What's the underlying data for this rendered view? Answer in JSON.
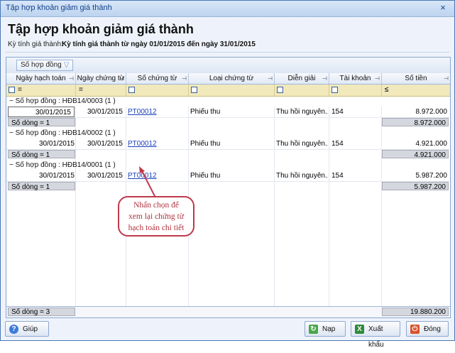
{
  "window": {
    "title": "Tập hợp khoản giảm giá thành",
    "close_glyph": "×"
  },
  "header": {
    "title": "Tập hợp khoản giảm giá thành",
    "period_label": "Kỳ tính giá thành:",
    "period_value": "Kỳ tính giá thành từ ngày 01/01/2015 đến ngày 31/01/2015"
  },
  "grid": {
    "group_by_chip": "Số hợp đồng",
    "columns": [
      "Ngày hạch toán",
      "Ngày chứng từ",
      "Số chứng từ",
      "Loại chứng từ",
      "Diễn giải",
      "Tài khoản",
      "Số tiền"
    ],
    "filter_ops": {
      "date": "=",
      "doc_date": "=",
      "amount": "≤"
    },
    "groups": [
      {
        "caption": "Số hợp đồng : HĐB14/0003 (1 )",
        "rows": [
          {
            "posting_date": "30/01/2015",
            "doc_date": "30/01/2015",
            "doc_no": "PT00012",
            "doc_type": "Phiếu thu",
            "description": "Thu hồi nguyên...",
            "account": "154",
            "amount": "8.972.000"
          }
        ],
        "summary_label": "Số dòng = 1",
        "summary_amount": "8.972.000"
      },
      {
        "caption": "Số hợp đồng : HĐB14/0002 (1 )",
        "rows": [
          {
            "posting_date": "30/01/2015",
            "doc_date": "30/01/2015",
            "doc_no": "PT00012",
            "doc_type": "Phiếu thu",
            "description": "Thu hồi nguyên...",
            "account": "154",
            "amount": "4.921.000"
          }
        ],
        "summary_label": "Số dòng = 1",
        "summary_amount": "4.921.000"
      },
      {
        "caption": "Số hợp đồng : HĐB14/0001 (1 )",
        "rows": [
          {
            "posting_date": "30/01/2015",
            "doc_date": "30/01/2015",
            "doc_no": "PT00012",
            "doc_type": "Phiếu thu",
            "description": "Thu hồi nguyên...",
            "account": "154",
            "amount": "5.987.200"
          }
        ],
        "summary_label": "Số dòng = 1",
        "summary_amount": "5.987.200"
      }
    ],
    "total_label": "Số dòng = 3",
    "total_amount": "19.880.200"
  },
  "callout": {
    "line1": "Nhấn chọn để",
    "line2": "xem lại chứng từ",
    "line3": "hạch toán chi tiết"
  },
  "buttons": {
    "help": "Giúp",
    "refresh": "Nạp",
    "export": "Xuất khẩu",
    "close": "Đóng"
  },
  "colors": {
    "title_text": "#15428b",
    "link": "#1a3fbf",
    "filter_row": "#f1e9bc",
    "callout": "#c0394b"
  }
}
